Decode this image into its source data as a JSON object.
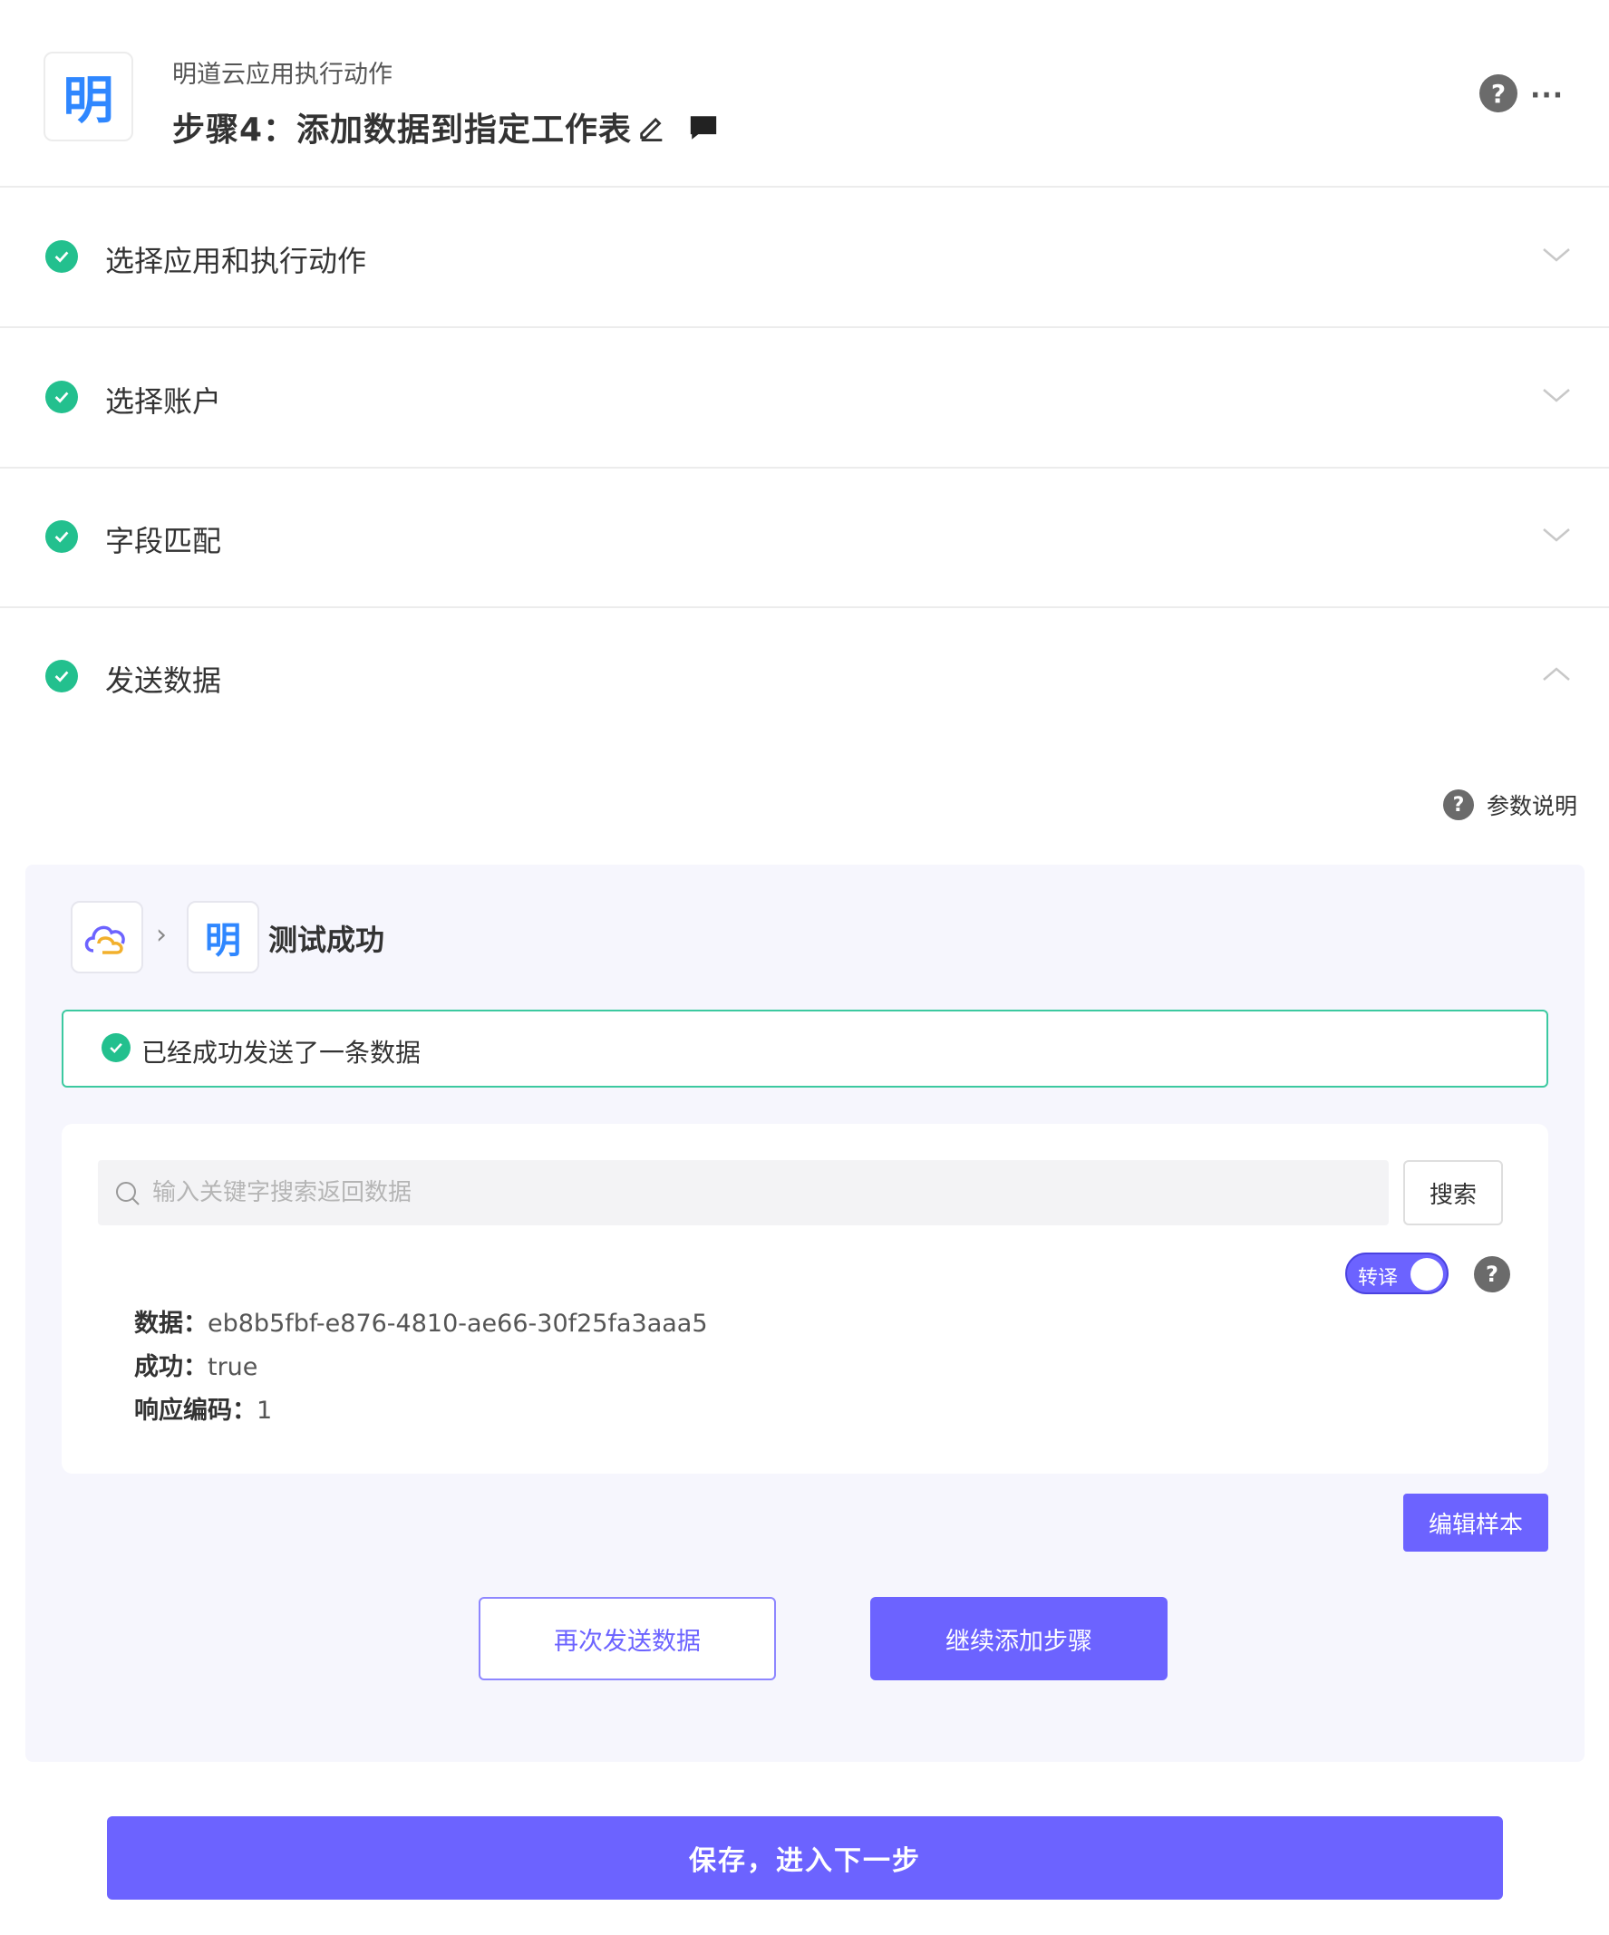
{
  "header": {
    "app_logo_char": "明",
    "app_name": "明道云应用执行动作",
    "step_title": "步骤4：添加数据到指定工作表",
    "more": "···",
    "help": "?"
  },
  "sections": [
    {
      "label": "选择应用和执行动作",
      "status": "done",
      "expanded": false
    },
    {
      "label": "选择账户",
      "status": "done",
      "expanded": false
    },
    {
      "label": "字段匹配",
      "status": "done",
      "expanded": false
    },
    {
      "label": "发送数据",
      "status": "done",
      "expanded": true
    }
  ],
  "param_help": {
    "icon": "?",
    "label": "参数说明"
  },
  "test": {
    "source_icon": "cloud-icon",
    "target_logo_char": "明",
    "arrow": "›",
    "status": "测试成功",
    "success_message": "已经成功发送了一条数据",
    "search": {
      "placeholder": "输入关键字搜索返回数据",
      "value": "",
      "button": "搜索"
    },
    "toggle": {
      "label": "转译",
      "on": true,
      "help": "?"
    },
    "results": [
      {
        "key": "数据：",
        "value": "eb8b5fbf-e876-4810-ae66-30f25fa3aaa5"
      },
      {
        "key": "成功：",
        "value": "true"
      },
      {
        "key": "响应编码：",
        "value": "1"
      }
    ],
    "edit_sample": "编辑样本",
    "resend": "再次发送数据",
    "continue": "继续添加步骤"
  },
  "save_next": "保存，进入下一步",
  "colors": {
    "accent": "#6c63ff",
    "success": "#23c08e",
    "brand_blue": "#2f87ff"
  }
}
